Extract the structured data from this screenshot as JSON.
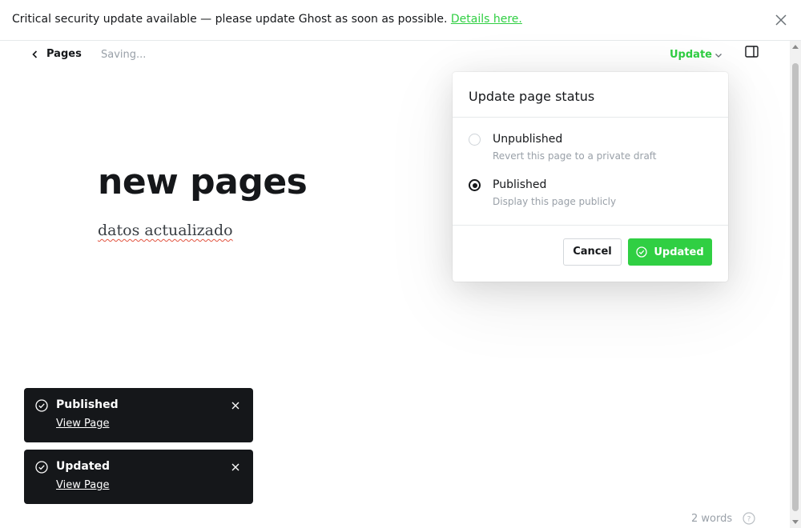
{
  "banner": {
    "message": "Critical security update available — please update Ghost as soon as possible.",
    "link_label": "Details here.",
    "close_icon": "close-icon"
  },
  "header": {
    "back_label": "Pages",
    "status_text": "Saving...",
    "update_label": "Update",
    "sidebar_icon": "sidebar-toggle-icon"
  },
  "content": {
    "title": "new pages",
    "body": "datos actualizado"
  },
  "popover": {
    "title": "Update page status",
    "options": [
      {
        "label": "Unpublished",
        "description": "Revert this page to a private draft",
        "selected": false
      },
      {
        "label": "Published",
        "description": "Display this page publicly",
        "selected": true
      }
    ],
    "cancel_label": "Cancel",
    "confirm_label": "Updated"
  },
  "toasts": [
    {
      "title": "Published",
      "link_label": "View Page"
    },
    {
      "title": "Updated",
      "link_label": "View Page"
    }
  ],
  "footer": {
    "word_count": "2 words",
    "help_icon": "help-icon"
  },
  "colors": {
    "accent": "#30cf43",
    "text": "#15171a",
    "muted": "#99a0a8",
    "toast_bg": "#15171a"
  }
}
